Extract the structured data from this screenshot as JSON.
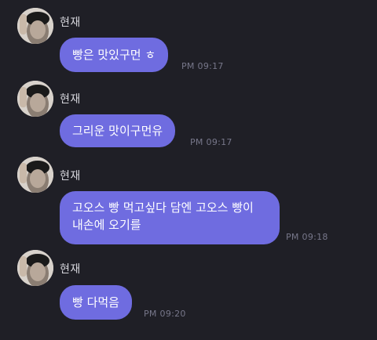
{
  "messages": [
    {
      "sender": "현재",
      "text": "빵은 맛있구먼 ㅎ",
      "time": "PM 09:17"
    },
    {
      "sender": "현재",
      "text": "그리운 맛이구먼유",
      "time": "PM 09:17"
    },
    {
      "sender": "현재",
      "lines": [
        "고오스 빵 먹고싶다 담엔 고오스 빵이",
        "내손에 오기를"
      ],
      "time": "PM 09:18"
    },
    {
      "sender": "현재",
      "text": "빵 다먹음",
      "time": "PM 09:20"
    }
  ],
  "colors": {
    "background": "#1f1f26",
    "bubble": "#6f6ce0",
    "bubble_text": "#ffffff",
    "name": "#d6d6dc",
    "time": "#77778a"
  },
  "icons": {
    "avatar": "profile-photo"
  }
}
